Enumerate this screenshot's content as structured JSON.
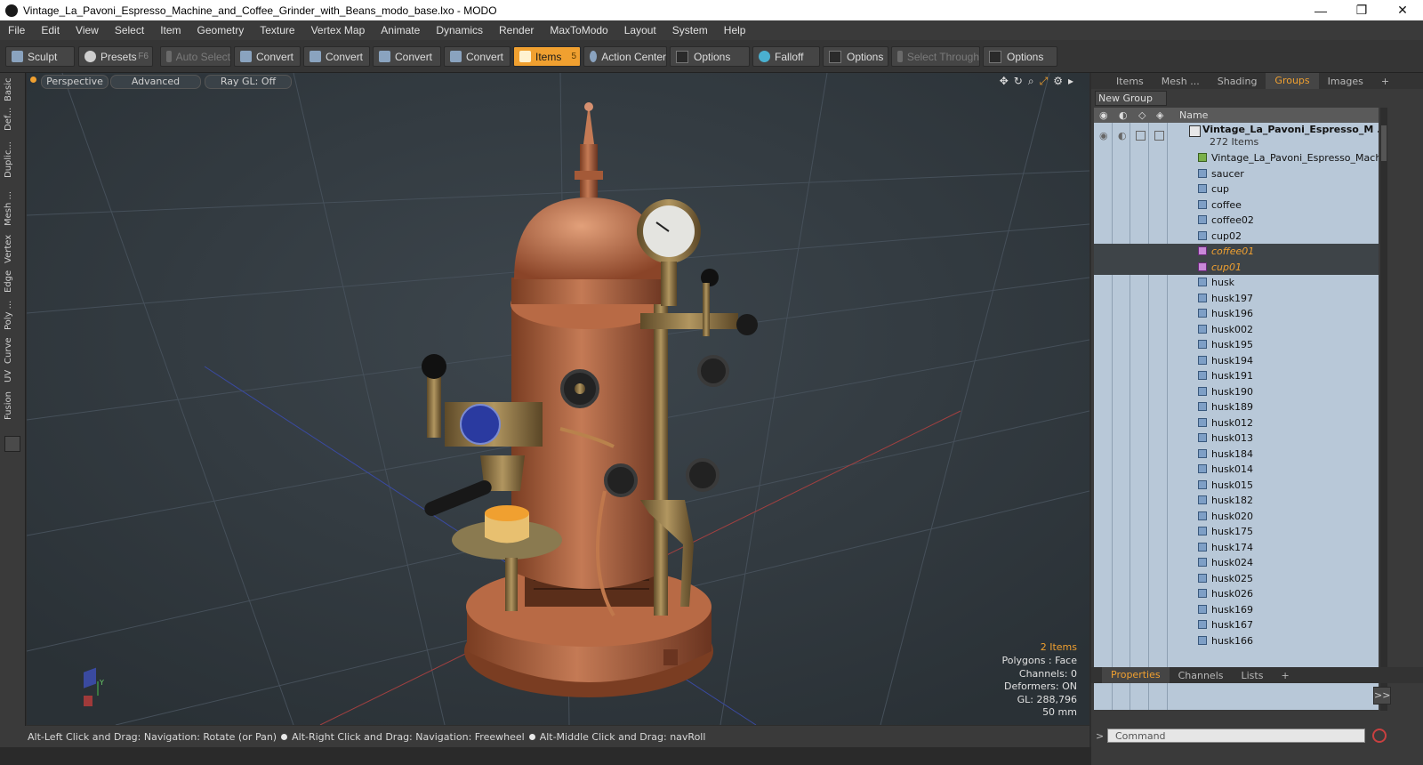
{
  "window": {
    "title": "Vintage_La_Pavoni_Espresso_Machine_and_Coffee_Grinder_with_Beans_modo_base.lxo - MODO",
    "minimize": "—",
    "maximize": "❐",
    "close": "✕"
  },
  "menu": [
    "File",
    "Edit",
    "View",
    "Select",
    "Item",
    "Geometry",
    "Texture",
    "Vertex Map",
    "Animate",
    "Dynamics",
    "Render",
    "MaxToModo",
    "Layout",
    "System",
    "Help"
  ],
  "toolbar": {
    "sculpt": "Sculpt",
    "presets": "Presets",
    "presets_key": "F6",
    "auto_select": "Auto Select",
    "convert1": "Convert",
    "convert2": "Convert",
    "convert3": "Convert",
    "convert4": "Convert",
    "items": "Items",
    "items_key": "5",
    "action_center": "Action Center",
    "options1": "Options",
    "falloff": "Falloff",
    "options2": "Options",
    "select_through": "Select Through",
    "options3": "Options"
  },
  "left_tabs": [
    "Basic",
    "Def...",
    "Duplic...",
    "Mesh ...",
    "Vertex",
    "Edge",
    "Poly ...",
    "Curve",
    "UV",
    "Fusion"
  ],
  "viewport": {
    "perspective": "Perspective",
    "advanced": "Advanced",
    "raygl": "Ray GL: Off",
    "stats": {
      "items": "2 Items",
      "polygons": "Polygons : Face",
      "channels": "Channels: 0",
      "deformers": "Deformers: ON",
      "gl": "GL: 288,796",
      "scale": "50 mm"
    }
  },
  "status_bar": {
    "hint1": "Alt-Left Click and Drag: Navigation: Rotate (or Pan)",
    "hint2": "Alt-Right Click and Drag: Navigation: Freewheel",
    "hint3": "Alt-Middle Click and Drag: navRoll"
  },
  "right_panel": {
    "tabs": [
      "Items",
      "Mesh ...",
      "Shading",
      "Groups",
      "Images"
    ],
    "active_tab": "Groups",
    "new_group": "New Group",
    "column_name": "Name",
    "group": {
      "name": "Vintage_La_Pavoni_Espresso_M ...",
      "count": "272 Items"
    },
    "items": [
      "Vintage_La_Pavoni_Espresso_Machi ...",
      "saucer",
      "cup",
      "coffee",
      "coffee02",
      "cup02",
      "coffee01",
      "cup01",
      "husk",
      "husk197",
      "husk196",
      "husk002",
      "husk195",
      "husk194",
      "husk191",
      "husk190",
      "husk189",
      "husk012",
      "husk013",
      "husk184",
      "husk014",
      "husk015",
      "husk182",
      "husk020",
      "husk175",
      "husk174",
      "husk024",
      "husk025",
      "husk026",
      "husk169",
      "husk167",
      "husk166"
    ],
    "selected_items": [
      "coffee01",
      "cup01"
    ],
    "bottom_tabs": [
      "Properties",
      "Channels",
      "Lists"
    ],
    "expand": ">>",
    "command_placeholder": "Command"
  },
  "colors": {
    "accent": "#f0a030",
    "viewport_bg": "#323a40",
    "tree_bg": "#b8c8d8",
    "copper": "#b86a45",
    "brass": "#9a8150"
  }
}
